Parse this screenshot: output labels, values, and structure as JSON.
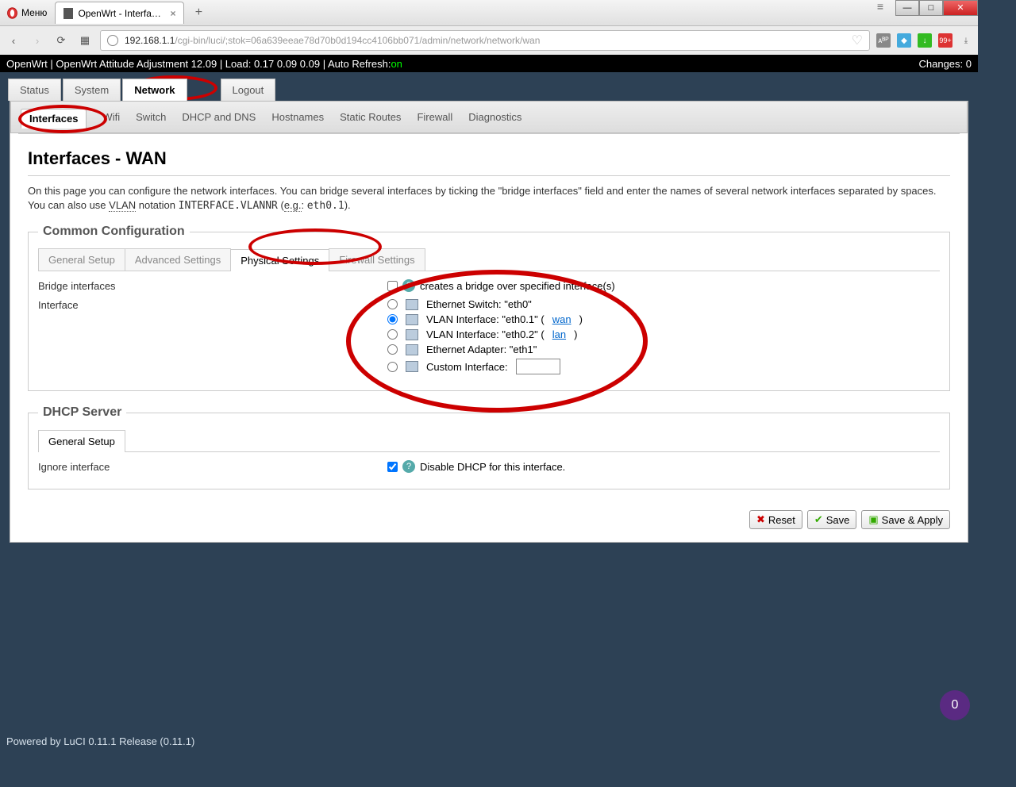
{
  "browser": {
    "menu_label": "Меню",
    "tab_title": "OpenWrt - Interfaces - Lu",
    "url_host": "192.168.1.1",
    "url_rest": "/cgi-bin/luci/;stok=06a639eeae78d70b0d194cc4106bb071/admin/network/network/wan"
  },
  "header": {
    "left": "OpenWrt | OpenWrt Attitude Adjustment 12.09 | Load: 0.17 0.09 0.09 | Auto Refresh: ",
    "on": "on",
    "changes": "Changes: 0"
  },
  "main_tabs": {
    "items": [
      "Status",
      "System",
      "Network",
      "Logout"
    ],
    "active": "Network"
  },
  "sub_tabs": {
    "items": [
      "Interfaces",
      "Wifi",
      "Switch",
      "DHCP and DNS",
      "Hostnames",
      "Static Routes",
      "Firewall",
      "Diagnostics"
    ],
    "active": "Interfaces"
  },
  "page": {
    "title": "Interfaces - WAN",
    "desc_1": "On this page you can configure the network interfaces. You can bridge several interfaces by ticking the \"bridge interfaces\" field and enter the names of several network interfaces separated by spaces. You can also use ",
    "desc_vlan": "VLAN",
    "desc_2": " notation ",
    "desc_mono": "INTERFACE.VLANNR",
    "desc_3": " (",
    "desc_eg": "e.g.",
    "desc_4": ": ",
    "desc_mono2": "eth0.1",
    "desc_5": ")."
  },
  "common": {
    "legend": "Common Configuration",
    "inner_tabs": [
      "General Setup",
      "Advanced Settings",
      "Physical Settings",
      "Firewall Settings"
    ],
    "inner_active": "Physical Settings",
    "bridge_label": "Bridge interfaces",
    "bridge_hint": "creates a bridge over specified interface(s)",
    "iface_label": "Interface",
    "radios": [
      {
        "label": "Ethernet Switch: \"eth0\"",
        "link": null,
        "checked": false
      },
      {
        "label": "VLAN Interface: \"eth0.1\" (",
        "link": "wan",
        "suffix": ")",
        "checked": true
      },
      {
        "label": "VLAN Interface: \"eth0.2\" (",
        "link": "lan",
        "suffix": ")",
        "checked": false
      },
      {
        "label": "Ethernet Adapter: \"eth1\"",
        "link": null,
        "checked": false
      },
      {
        "label": "Custom Interface:",
        "link": null,
        "custom": true,
        "checked": false
      }
    ]
  },
  "dhcp": {
    "legend": "DHCP Server",
    "tab": "General Setup",
    "ignore_label": "Ignore interface",
    "ignore_hint_1": "Disable ",
    "ignore_hint_dhcp": "DHCP",
    "ignore_hint_2": " for this interface."
  },
  "actions": {
    "reset": "Reset",
    "save": "Save",
    "save_apply": "Save & Apply"
  },
  "footer": "Powered by LuCI 0.11.1 Release (0.11.1)",
  "float_badge": "0"
}
